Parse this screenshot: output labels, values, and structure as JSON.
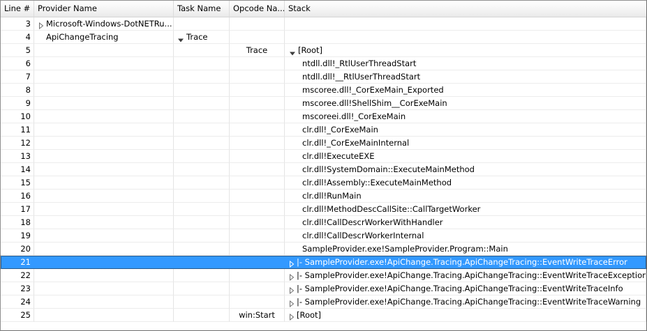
{
  "columns": [
    "Line #",
    "Provider Name",
    "Task Name",
    "Opcode Na...",
    "Stack"
  ],
  "colors": {
    "selection": "#3399ff",
    "header_bg": "#f3f3f3",
    "grid": "#e4e4e4"
  },
  "rows": [
    {
      "line": "3",
      "provider": "Microsoft-Windows-DotNETRu...",
      "provider_expander": "collapsed",
      "task": "",
      "task_expander": "none",
      "opcode": "",
      "stack": "",
      "stack_expander": "none",
      "stack_indent": false
    },
    {
      "line": "4",
      "provider": "ApiChangeTracing",
      "provider_expander": "none",
      "task": "Trace",
      "task_expander": "expanded",
      "opcode": "",
      "stack": "",
      "stack_expander": "none",
      "stack_indent": false
    },
    {
      "line": "5",
      "provider": "",
      "provider_expander": "none",
      "task": "",
      "task_expander": "none",
      "opcode": "Trace",
      "stack": "[Root]",
      "stack_expander": "expanded",
      "stack_indent": false
    },
    {
      "line": "6",
      "provider": "",
      "provider_expander": "none",
      "task": "",
      "task_expander": "none",
      "opcode": "",
      "stack": "ntdll.dll!_RtlUserThreadStart",
      "stack_expander": "none",
      "stack_indent": true
    },
    {
      "line": "7",
      "provider": "",
      "provider_expander": "none",
      "task": "",
      "task_expander": "none",
      "opcode": "",
      "stack": "ntdll.dll!__RtlUserThreadStart",
      "stack_expander": "none",
      "stack_indent": true
    },
    {
      "line": "8",
      "provider": "",
      "provider_expander": "none",
      "task": "",
      "task_expander": "none",
      "opcode": "",
      "stack": "mscoree.dll!_CorExeMain_Exported",
      "stack_expander": "none",
      "stack_indent": true
    },
    {
      "line": "9",
      "provider": "",
      "provider_expander": "none",
      "task": "",
      "task_expander": "none",
      "opcode": "",
      "stack": "mscoree.dll!ShellShim__CorExeMain",
      "stack_expander": "none",
      "stack_indent": true
    },
    {
      "line": "10",
      "provider": "",
      "provider_expander": "none",
      "task": "",
      "task_expander": "none",
      "opcode": "",
      "stack": "mscoreei.dll!_CorExeMain",
      "stack_expander": "none",
      "stack_indent": true
    },
    {
      "line": "11",
      "provider": "",
      "provider_expander": "none",
      "task": "",
      "task_expander": "none",
      "opcode": "",
      "stack": "clr.dll!_CorExeMain",
      "stack_expander": "none",
      "stack_indent": true
    },
    {
      "line": "12",
      "provider": "",
      "provider_expander": "none",
      "task": "",
      "task_expander": "none",
      "opcode": "",
      "stack": "clr.dll!_CorExeMainInternal",
      "stack_expander": "none",
      "stack_indent": true
    },
    {
      "line": "13",
      "provider": "",
      "provider_expander": "none",
      "task": "",
      "task_expander": "none",
      "opcode": "",
      "stack": "clr.dll!ExecuteEXE",
      "stack_expander": "none",
      "stack_indent": true
    },
    {
      "line": "14",
      "provider": "",
      "provider_expander": "none",
      "task": "",
      "task_expander": "none",
      "opcode": "",
      "stack": "clr.dll!SystemDomain::ExecuteMainMethod",
      "stack_expander": "none",
      "stack_indent": true
    },
    {
      "line": "15",
      "provider": "",
      "provider_expander": "none",
      "task": "",
      "task_expander": "none",
      "opcode": "",
      "stack": "clr.dll!Assembly::ExecuteMainMethod",
      "stack_expander": "none",
      "stack_indent": true
    },
    {
      "line": "16",
      "provider": "",
      "provider_expander": "none",
      "task": "",
      "task_expander": "none",
      "opcode": "",
      "stack": "clr.dll!RunMain",
      "stack_expander": "none",
      "stack_indent": true
    },
    {
      "line": "17",
      "provider": "",
      "provider_expander": "none",
      "task": "",
      "task_expander": "none",
      "opcode": "",
      "stack": "clr.dll!MethodDescCallSite::CallTargetWorker",
      "stack_expander": "none",
      "stack_indent": true
    },
    {
      "line": "18",
      "provider": "",
      "provider_expander": "none",
      "task": "",
      "task_expander": "none",
      "opcode": "",
      "stack": "clr.dll!CallDescrWorkerWithHandler",
      "stack_expander": "none",
      "stack_indent": true
    },
    {
      "line": "19",
      "provider": "",
      "provider_expander": "none",
      "task": "",
      "task_expander": "none",
      "opcode": "",
      "stack": "clr.dll!CallDescrWorkerInternal",
      "stack_expander": "none",
      "stack_indent": true
    },
    {
      "line": "20",
      "provider": "",
      "provider_expander": "none",
      "task": "",
      "task_expander": "none",
      "opcode": "",
      "stack": "SampleProvider.exe!SampleProvider.Program::Main",
      "stack_expander": "none",
      "stack_indent": true
    },
    {
      "line": "21",
      "provider": "",
      "provider_expander": "none",
      "task": "",
      "task_expander": "none",
      "opcode": "",
      "stack": "|- SampleProvider.exe!ApiChange.Tracing.ApiChangeTracing::EventWriteTraceError",
      "stack_expander": "collapsed",
      "stack_indent": false,
      "selected": true
    },
    {
      "line": "22",
      "provider": "",
      "provider_expander": "none",
      "task": "",
      "task_expander": "none",
      "opcode": "",
      "stack": "|- SampleProvider.exe!ApiChange.Tracing.ApiChangeTracing::EventWriteTraceException",
      "stack_expander": "collapsed",
      "stack_indent": false
    },
    {
      "line": "23",
      "provider": "",
      "provider_expander": "none",
      "task": "",
      "task_expander": "none",
      "opcode": "",
      "stack": "|- SampleProvider.exe!ApiChange.Tracing.ApiChangeTracing::EventWriteTraceInfo",
      "stack_expander": "collapsed",
      "stack_indent": false
    },
    {
      "line": "24",
      "provider": "",
      "provider_expander": "none",
      "task": "",
      "task_expander": "none",
      "opcode": "",
      "stack": "|- SampleProvider.exe!ApiChange.Tracing.ApiChangeTracing::EventWriteTraceWarning",
      "stack_expander": "collapsed",
      "stack_indent": false
    },
    {
      "line": "25",
      "provider": "",
      "provider_expander": "none",
      "task": "",
      "task_expander": "none",
      "opcode": "win:Start",
      "stack": "[Root]",
      "stack_expander": "collapsed",
      "stack_indent": false
    }
  ]
}
